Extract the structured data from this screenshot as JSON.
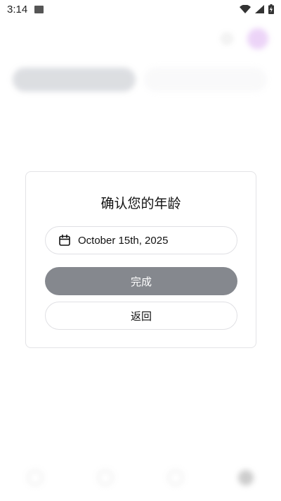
{
  "status_bar": {
    "time": "3:14",
    "icons": [
      "image-icon",
      "wifi-icon",
      "signal-icon",
      "battery-charging-icon"
    ]
  },
  "dialog": {
    "title": "确认您的年龄",
    "date_value": "October 15th, 2025",
    "done_label": "完成",
    "back_label": "返回"
  },
  "colors": {
    "done_button_bg": "#85888e",
    "dialog_border": "#e3e3e6",
    "avatar": "#d9a8f0"
  }
}
